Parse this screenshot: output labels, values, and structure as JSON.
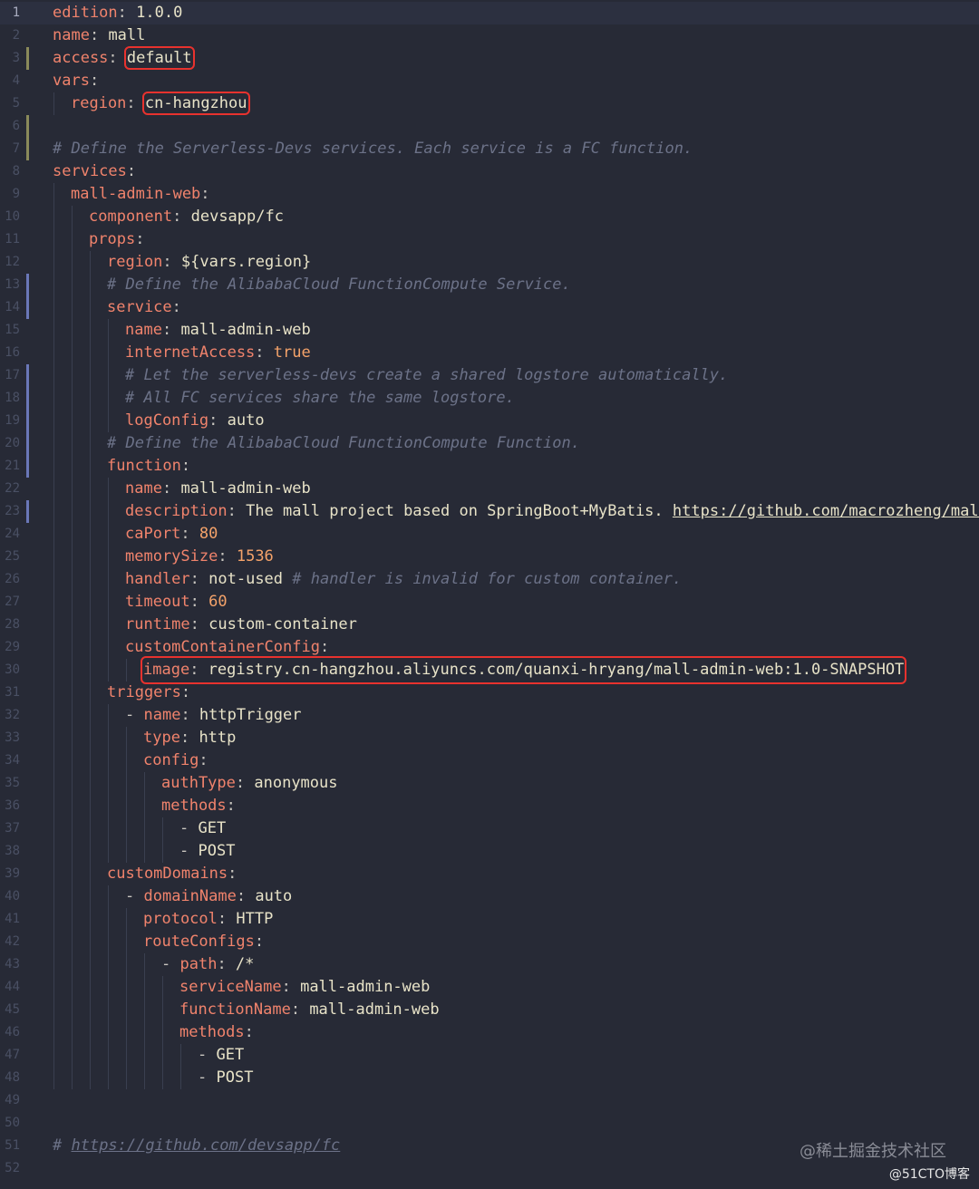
{
  "editor": {
    "lines": [
      {
        "n": "1",
        "indent": 0,
        "active": true,
        "parts": [
          {
            "t": "edition",
            "c": "k"
          },
          {
            "t": ": ",
            "c": "p"
          },
          {
            "t": "1.0.0",
            "c": "v"
          }
        ]
      },
      {
        "n": "2",
        "indent": 0,
        "parts": [
          {
            "t": "name",
            "c": "k"
          },
          {
            "t": ": ",
            "c": "p"
          },
          {
            "t": "mall",
            "c": "v"
          }
        ]
      },
      {
        "n": "3",
        "indent": 0,
        "git": "mod",
        "parts": [
          {
            "t": "access",
            "c": "k"
          },
          {
            "t": ": ",
            "c": "p"
          },
          {
            "t": "default",
            "c": "v",
            "hl": true
          }
        ]
      },
      {
        "n": "4",
        "indent": 0,
        "parts": [
          {
            "t": "vars",
            "c": "k"
          },
          {
            "t": ":",
            "c": "p"
          }
        ]
      },
      {
        "n": "5",
        "indent": 1,
        "parts": [
          {
            "t": "region",
            "c": "k"
          },
          {
            "t": ": ",
            "c": "p"
          },
          {
            "t": "cn-hangzhou",
            "c": "v",
            "hl": true
          }
        ]
      },
      {
        "n": "6",
        "indent": 0,
        "git": "mod",
        "parts": []
      },
      {
        "n": "7",
        "indent": 0,
        "git": "mod",
        "parts": [
          {
            "t": "# Define the Serverless-Devs services. Each service is a FC function.",
            "c": "c"
          }
        ]
      },
      {
        "n": "8",
        "indent": 0,
        "parts": [
          {
            "t": "services",
            "c": "k"
          },
          {
            "t": ":",
            "c": "p"
          }
        ]
      },
      {
        "n": "9",
        "indent": 1,
        "parts": [
          {
            "t": "mall-admin-web",
            "c": "k"
          },
          {
            "t": ":",
            "c": "p"
          }
        ]
      },
      {
        "n": "10",
        "indent": 2,
        "parts": [
          {
            "t": "component",
            "c": "k"
          },
          {
            "t": ": ",
            "c": "p"
          },
          {
            "t": "devsapp/fc",
            "c": "v"
          }
        ]
      },
      {
        "n": "11",
        "indent": 2,
        "parts": [
          {
            "t": "props",
            "c": "k"
          },
          {
            "t": ":",
            "c": "p"
          }
        ]
      },
      {
        "n": "12",
        "indent": 3,
        "parts": [
          {
            "t": "region",
            "c": "k"
          },
          {
            "t": ": ",
            "c": "p"
          },
          {
            "t": "${vars.region}",
            "c": "v"
          }
        ]
      },
      {
        "n": "13",
        "indent": 3,
        "git": "add",
        "parts": [
          {
            "t": "# Define the AlibabaCloud FunctionCompute Service.",
            "c": "c"
          }
        ]
      },
      {
        "n": "14",
        "indent": 3,
        "git": "add",
        "parts": [
          {
            "t": "service",
            "c": "k"
          },
          {
            "t": ":",
            "c": "p"
          }
        ]
      },
      {
        "n": "15",
        "indent": 4,
        "parts": [
          {
            "t": "name",
            "c": "k"
          },
          {
            "t": ": ",
            "c": "p"
          },
          {
            "t": "mall-admin-web",
            "c": "v"
          }
        ]
      },
      {
        "n": "16",
        "indent": 4,
        "parts": [
          {
            "t": "internetAccess",
            "c": "k"
          },
          {
            "t": ": ",
            "c": "p"
          },
          {
            "t": "true",
            "c": "n"
          }
        ]
      },
      {
        "n": "17",
        "indent": 4,
        "git": "add",
        "parts": [
          {
            "t": "# Let the serverless-devs create a shared logstore automatically.",
            "c": "c"
          }
        ]
      },
      {
        "n": "18",
        "indent": 4,
        "git": "add",
        "parts": [
          {
            "t": "# All FC services share the same logstore.",
            "c": "c"
          }
        ]
      },
      {
        "n": "19",
        "indent": 4,
        "git": "add",
        "parts": [
          {
            "t": "logConfig",
            "c": "k"
          },
          {
            "t": ": ",
            "c": "p"
          },
          {
            "t": "auto",
            "c": "v"
          }
        ]
      },
      {
        "n": "20",
        "indent": 3,
        "git": "add",
        "parts": [
          {
            "t": "# Define the AlibabaCloud FunctionCompute Function.",
            "c": "c"
          }
        ]
      },
      {
        "n": "21",
        "indent": 3,
        "git": "add",
        "parts": [
          {
            "t": "function",
            "c": "k"
          },
          {
            "t": ":",
            "c": "p"
          }
        ]
      },
      {
        "n": "22",
        "indent": 4,
        "parts": [
          {
            "t": "name",
            "c": "k"
          },
          {
            "t": ": ",
            "c": "p"
          },
          {
            "t": "mall-admin-web",
            "c": "v"
          }
        ]
      },
      {
        "n": "23",
        "indent": 4,
        "git": "add",
        "parts": [
          {
            "t": "description",
            "c": "k"
          },
          {
            "t": ": ",
            "c": "p"
          },
          {
            "t": "The mall project based on SpringBoot+MyBatis. ",
            "c": "v"
          },
          {
            "t": "https://github.com/macrozheng/mall-",
            "c": "u"
          }
        ]
      },
      {
        "n": "24",
        "indent": 4,
        "parts": [
          {
            "t": "caPort",
            "c": "k"
          },
          {
            "t": ": ",
            "c": "p"
          },
          {
            "t": "80",
            "c": "n"
          }
        ]
      },
      {
        "n": "25",
        "indent": 4,
        "parts": [
          {
            "t": "memorySize",
            "c": "k"
          },
          {
            "t": ": ",
            "c": "p"
          },
          {
            "t": "1536",
            "c": "n"
          }
        ]
      },
      {
        "n": "26",
        "indent": 4,
        "parts": [
          {
            "t": "handler",
            "c": "k"
          },
          {
            "t": ": ",
            "c": "p"
          },
          {
            "t": "not-used ",
            "c": "v"
          },
          {
            "t": "# handler is invalid for custom container.",
            "c": "c"
          }
        ]
      },
      {
        "n": "27",
        "indent": 4,
        "parts": [
          {
            "t": "timeout",
            "c": "k"
          },
          {
            "t": ": ",
            "c": "p"
          },
          {
            "t": "60",
            "c": "n"
          }
        ]
      },
      {
        "n": "28",
        "indent": 4,
        "parts": [
          {
            "t": "runtime",
            "c": "k"
          },
          {
            "t": ": ",
            "c": "p"
          },
          {
            "t": "custom-container",
            "c": "v"
          }
        ]
      },
      {
        "n": "29",
        "indent": 4,
        "parts": [
          {
            "t": "customContainerConfig",
            "c": "k"
          },
          {
            "t": ":",
            "c": "p"
          }
        ]
      },
      {
        "n": "30",
        "indent": 5,
        "boxline": true,
        "parts": [
          {
            "t": "image",
            "c": "k"
          },
          {
            "t": ": ",
            "c": "p"
          },
          {
            "t": "registry.cn-hangzhou.aliyuncs.com/quanxi-hryang/mall-admin-web:1.0-SNAPSHOT",
            "c": "v"
          }
        ]
      },
      {
        "n": "31",
        "indent": 3,
        "parts": [
          {
            "t": "triggers",
            "c": "k"
          },
          {
            "t": ":",
            "c": "p"
          }
        ]
      },
      {
        "n": "32",
        "indent": 4,
        "parts": [
          {
            "t": "- ",
            "c": "p"
          },
          {
            "t": "name",
            "c": "k"
          },
          {
            "t": ": ",
            "c": "p"
          },
          {
            "t": "httpTrigger",
            "c": "v"
          }
        ]
      },
      {
        "n": "33",
        "indent": 5,
        "parts": [
          {
            "t": "type",
            "c": "k"
          },
          {
            "t": ": ",
            "c": "p"
          },
          {
            "t": "http",
            "c": "v"
          }
        ]
      },
      {
        "n": "34",
        "indent": 5,
        "parts": [
          {
            "t": "config",
            "c": "k"
          },
          {
            "t": ":",
            "c": "p"
          }
        ]
      },
      {
        "n": "35",
        "indent": 6,
        "parts": [
          {
            "t": "authType",
            "c": "k"
          },
          {
            "t": ": ",
            "c": "p"
          },
          {
            "t": "anonymous",
            "c": "v"
          }
        ]
      },
      {
        "n": "36",
        "indent": 6,
        "parts": [
          {
            "t": "methods",
            "c": "k"
          },
          {
            "t": ":",
            "c": "p"
          }
        ]
      },
      {
        "n": "37",
        "indent": 7,
        "parts": [
          {
            "t": "- ",
            "c": "p"
          },
          {
            "t": "GET",
            "c": "v"
          }
        ]
      },
      {
        "n": "38",
        "indent": 7,
        "parts": [
          {
            "t": "- ",
            "c": "p"
          },
          {
            "t": "POST",
            "c": "v"
          }
        ]
      },
      {
        "n": "39",
        "indent": 3,
        "parts": [
          {
            "t": "customDomains",
            "c": "k"
          },
          {
            "t": ":",
            "c": "p"
          }
        ]
      },
      {
        "n": "40",
        "indent": 4,
        "parts": [
          {
            "t": "- ",
            "c": "p"
          },
          {
            "t": "domainName",
            "c": "k"
          },
          {
            "t": ": ",
            "c": "p"
          },
          {
            "t": "auto",
            "c": "v"
          }
        ]
      },
      {
        "n": "41",
        "indent": 5,
        "parts": [
          {
            "t": "protocol",
            "c": "k"
          },
          {
            "t": ": ",
            "c": "p"
          },
          {
            "t": "HTTP",
            "c": "v"
          }
        ]
      },
      {
        "n": "42",
        "indent": 5,
        "parts": [
          {
            "t": "routeConfigs",
            "c": "k"
          },
          {
            "t": ":",
            "c": "p"
          }
        ]
      },
      {
        "n": "43",
        "indent": 6,
        "parts": [
          {
            "t": "- ",
            "c": "p"
          },
          {
            "t": "path",
            "c": "k"
          },
          {
            "t": ": ",
            "c": "p"
          },
          {
            "t": "/*",
            "c": "v"
          }
        ]
      },
      {
        "n": "44",
        "indent": 7,
        "parts": [
          {
            "t": "serviceName",
            "c": "k"
          },
          {
            "t": ": ",
            "c": "p"
          },
          {
            "t": "mall-admin-web",
            "c": "v"
          }
        ]
      },
      {
        "n": "45",
        "indent": 7,
        "parts": [
          {
            "t": "functionName",
            "c": "k"
          },
          {
            "t": ": ",
            "c": "p"
          },
          {
            "t": "mall-admin-web",
            "c": "v"
          }
        ]
      },
      {
        "n": "46",
        "indent": 7,
        "parts": [
          {
            "t": "methods",
            "c": "k"
          },
          {
            "t": ":",
            "c": "p"
          }
        ]
      },
      {
        "n": "47",
        "indent": 8,
        "parts": [
          {
            "t": "- ",
            "c": "p"
          },
          {
            "t": "GET",
            "c": "v"
          }
        ]
      },
      {
        "n": "48",
        "indent": 8,
        "parts": [
          {
            "t": "- ",
            "c": "p"
          },
          {
            "t": "POST",
            "c": "v"
          }
        ]
      },
      {
        "n": "49",
        "indent": 0,
        "parts": []
      },
      {
        "n": "50",
        "indent": 0,
        "parts": []
      },
      {
        "n": "51",
        "indent": 0,
        "parts": [
          {
            "t": "# ",
            "c": "c"
          },
          {
            "t": "https://github.com/devsapp/fc",
            "c": "cu"
          }
        ]
      },
      {
        "n": "52",
        "indent": 0,
        "parts": []
      }
    ]
  },
  "watermark": {
    "primary": "@稀土掘金技术社区",
    "secondary": "@51CTO博客"
  },
  "colors": {
    "background": "#272a36",
    "key": "#f0836c",
    "value": "#e8e3c8",
    "comment": "#6c7288",
    "highlight_box": "#e8322e"
  }
}
